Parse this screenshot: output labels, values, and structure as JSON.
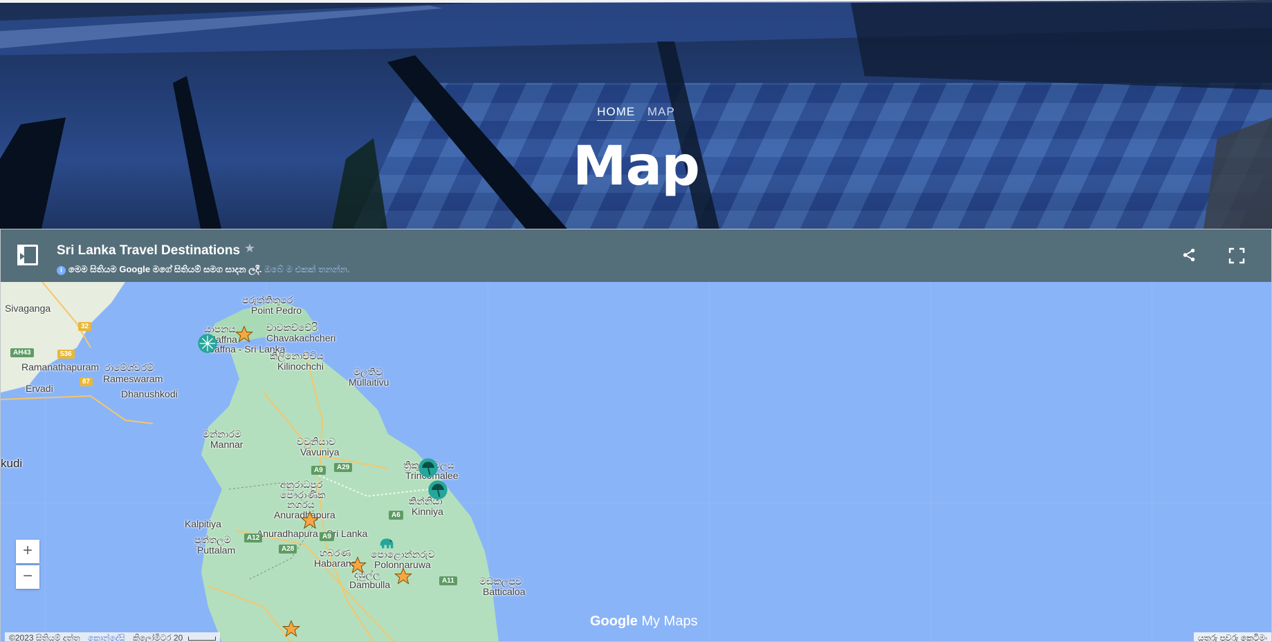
{
  "nav": {
    "home": "HOME",
    "map": "MAP"
  },
  "hero": {
    "title": "Map"
  },
  "map_header": {
    "title": "Sri Lanka Travel Destinations",
    "notice": "මෙම සිතියම Google මගේ සිතියම් සමග සාදන ලදී.",
    "notice_link": "ඔබේ ම එකක් තනන්න."
  },
  "map": {
    "labels": {
      "sivaganga": "Sivaganga",
      "point_pedro_si": "පරුත්තිතුරෙ",
      "point_pedro": "Point Pedro",
      "jaffna_si": "යාපනය",
      "jaffna": "Jaffna",
      "jaffna_sl": "Jaffna - Sri Lanka",
      "chavakachcheri_si": "චාවකච්චේරි",
      "chavakachcheri": "Chavakachcheri",
      "kilinochchi_si": "කිලිනොච්චිය",
      "kilinochchi": "Kilinochchi",
      "ramanathapuram": "Ramanathapuram",
      "rameswaram_si": "රාමේශ්වරම්",
      "rameswaram": "Rameswaram",
      "mullaitivu_si": "මුලතිවු",
      "mullaitivu": "Mullaitivu",
      "ervadi": "Ervadi",
      "dhanushkodi": "Dhanushkodi",
      "mannar_si": "මන්නාරම",
      "mannar": "Mannar",
      "vavuniya_si": "වවුනියාව",
      "vavuniya": "Vavuniya",
      "kudi": "kudi",
      "trinco_si": "ත්‍රිකුණාමලය",
      "trincomalee": "Trincomalee",
      "anuradhapura_si1": "අනුරාධපුර",
      "anuradhapura_si2": "පෞරාණික",
      "anuradhapura_si3": "නගරය",
      "anuradhapura": "Anuradhapura",
      "kinniya_si": "කින්නියා",
      "kinniya": "Kinniya",
      "kalpitiya": "Kalpitiya",
      "anuradhapura_sl": "Anuradhapura - Sri Lanka",
      "puttalam_si": "පුත්තලම",
      "puttalam": "Puttalam",
      "habarana_si": "හබරණ",
      "habarana": "Habarana",
      "polonnaruwa_si": "පොළොන්නරුව",
      "polonnaruwa": "Polonnaruwa",
      "dambulla_si": "දඹුල්ල",
      "dambulla": "Dambulla",
      "batticaloa_si": "මඩකලපුව",
      "batticaloa": "Batticaloa"
    },
    "shields": {
      "s32": "32",
      "ah43": "AH43",
      "s536": "536",
      "s87": "87",
      "a9a": "A9",
      "a29": "A29",
      "a6": "A6",
      "a12": "A12",
      "a9b": "A9",
      "a28": "A28",
      "a11": "A11"
    },
    "zoom_in": "+",
    "zoom_out": "−",
    "brand_google": "Google",
    "brand_mymaps": "My Maps",
    "footer": {
      "copyright": "©2023 සිතියම් දත්ත",
      "terms": "කොන්දේසි",
      "scale": "කිලෝමීටර 20"
    },
    "shortcuts": "යතුරු පුවරු කෙටිමං"
  },
  "colors": {
    "header_bar": "#546e7a",
    "water": "#8ab4f8",
    "land": "#a8dab5",
    "marker_teal": "#26a69a",
    "marker_orange": "#f4a742"
  }
}
